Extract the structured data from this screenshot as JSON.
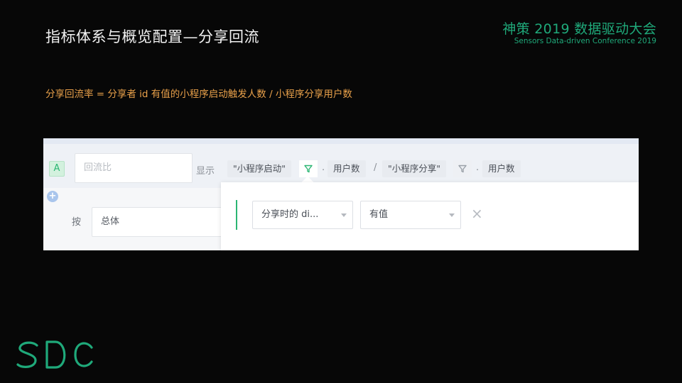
{
  "slide": {
    "title": "指标体系与概览配置—分享回流",
    "conference_cn": "神策 2019 数据驱动大会",
    "conference_en": "Sensors Data-driven Conference 2019",
    "formula": "分享回流率 = 分享者 id 有值的小程序启动触发人数 / 小程序分享用户数",
    "logo_text": "SDC"
  },
  "metric": {
    "badge": "A",
    "name_placeholder": "回流比",
    "show_label": "显示",
    "event1": "\"小程序启动\"",
    "dot1": ".",
    "measure1": "用户数",
    "divider": "/",
    "event2": "\"小程序分享\"",
    "dot2": ".",
    "measure2": "用户数"
  },
  "group": {
    "by_label": "按",
    "value": "总体"
  },
  "filter": {
    "property": "分享时的 di...",
    "condition": "有值",
    "remove": "×"
  },
  "colors": {
    "accent_green": "#2bb673",
    "brand_green": "#1fa97a",
    "formula_orange": "#e8a04a"
  },
  "icons": [
    "filter-icon",
    "add-icon",
    "close-icon",
    "dropdown-caret-icon"
  ]
}
